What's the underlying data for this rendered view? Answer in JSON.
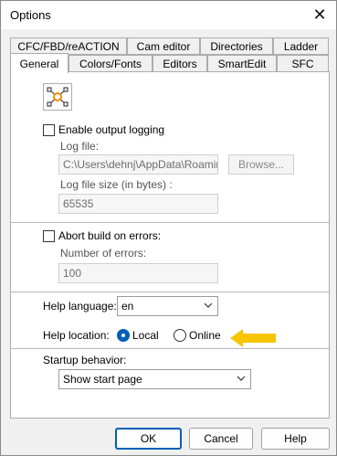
{
  "window": {
    "title": "Options",
    "close_symbol": "✕"
  },
  "tabs": {
    "row1": [
      "CFC/FBD/reACTION",
      "Cam editor",
      "Directories",
      "Ladder"
    ],
    "row2": [
      "General",
      "Colors/Fonts",
      "Editors",
      "SmartEdit",
      "SFC"
    ],
    "active": "General"
  },
  "general": {
    "tool_icon": "cfc-network-icon",
    "logging": {
      "enable_label": "Enable output logging",
      "enabled": false,
      "log_file_label": "Log file:",
      "log_file_value": "C:\\Users\\dehnj\\AppData\\Roaming\\",
      "browse_label": "Browse...",
      "size_label": "Log file size (in bytes) :",
      "size_value": "65535"
    },
    "abort": {
      "label": "Abort build on errors:",
      "enabled": false,
      "errors_label": "Number of errors:",
      "errors_value": "100"
    },
    "help": {
      "language_label": "Help language:",
      "language_value": "en",
      "location_label": "Help location:",
      "local_label": "Local",
      "online_label": "Online",
      "selected": "Local"
    },
    "startup": {
      "label": "Startup behavior:",
      "value": "Show start page"
    },
    "annotation": {
      "arrow_color": "#f6c500"
    }
  },
  "buttons": {
    "ok": "OK",
    "cancel": "Cancel",
    "help": "Help"
  },
  "colors": {
    "accent": "#005fb8",
    "tool_icon": "#f28c00"
  }
}
